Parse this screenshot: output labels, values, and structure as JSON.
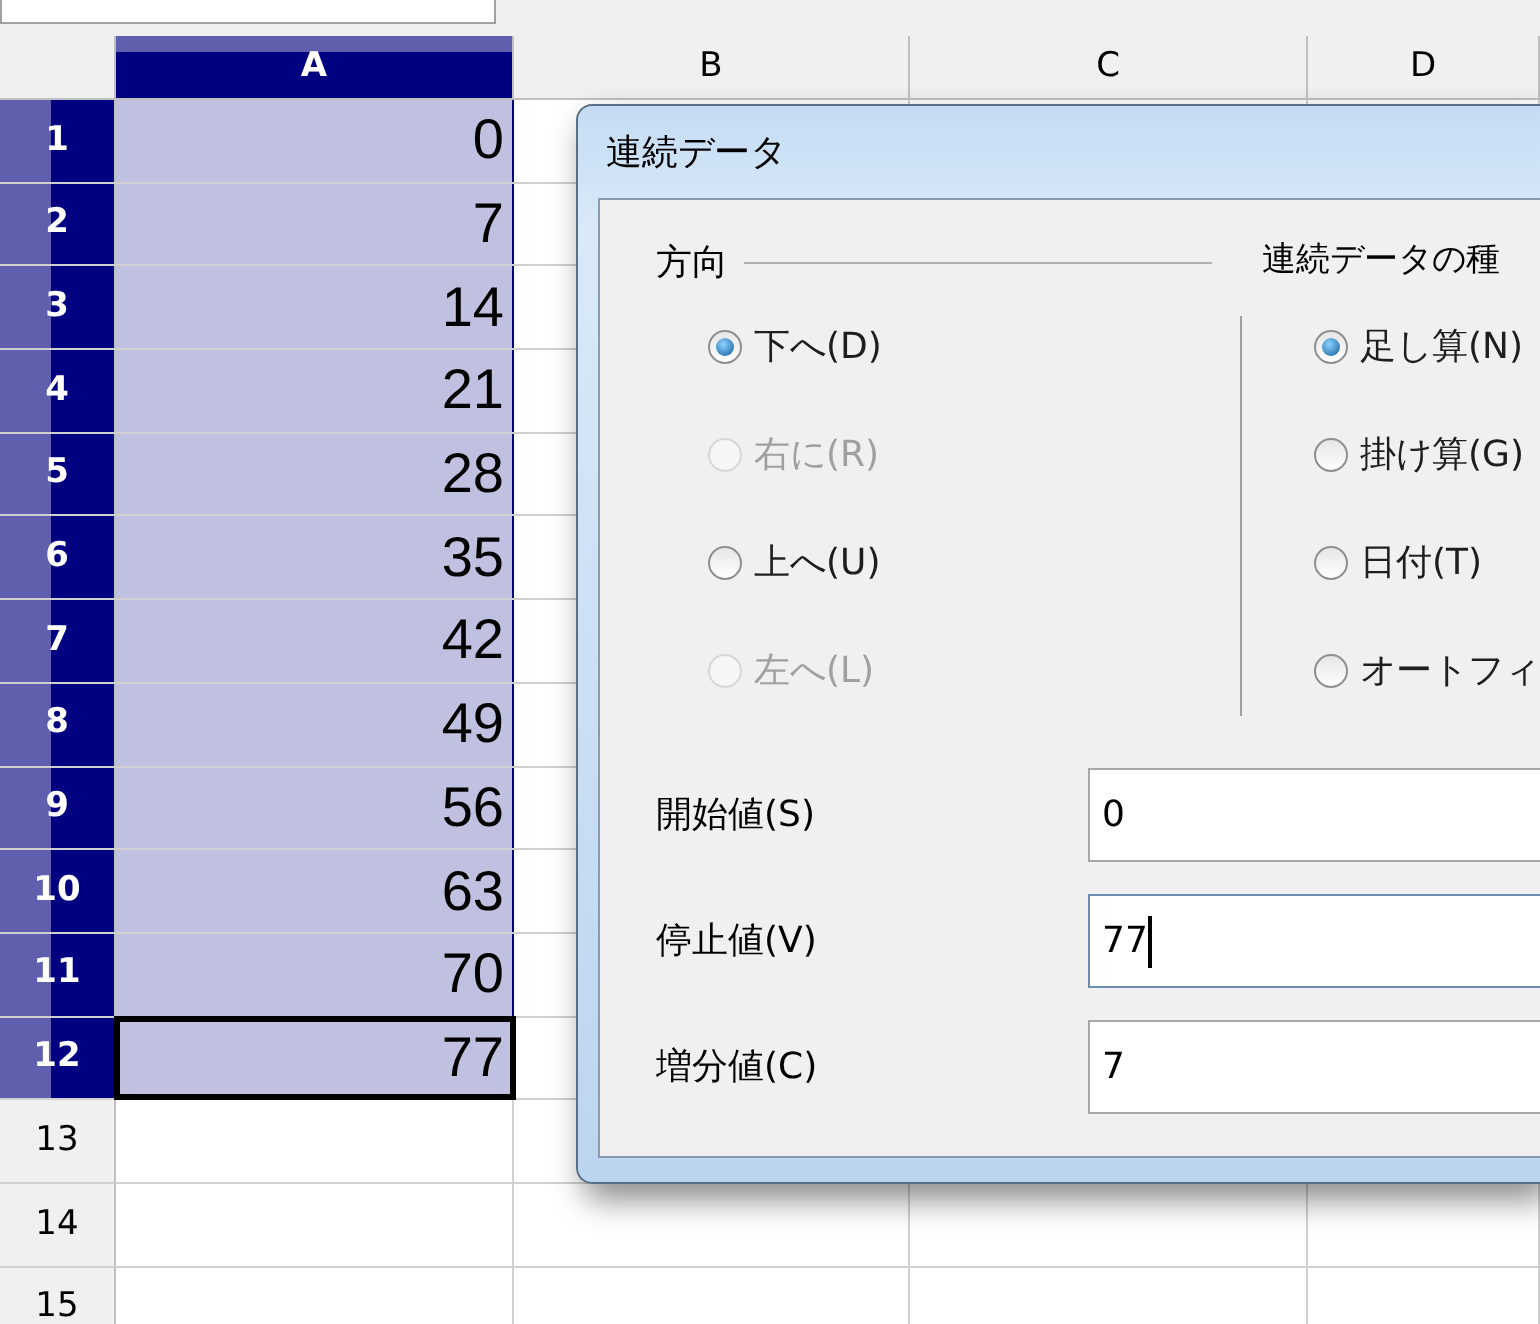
{
  "column_headers": [
    {
      "label": "A",
      "selected": true
    },
    {
      "label": "B",
      "selected": false
    },
    {
      "label": "C",
      "selected": false
    },
    {
      "label": "D",
      "selected": false
    }
  ],
  "rows": [
    {
      "header": "1",
      "selected": true,
      "active": false,
      "value": "0"
    },
    {
      "header": "2",
      "selected": true,
      "active": false,
      "value": "7"
    },
    {
      "header": "3",
      "selected": true,
      "active": false,
      "value": "14"
    },
    {
      "header": "4",
      "selected": true,
      "active": false,
      "value": "21"
    },
    {
      "header": "5",
      "selected": true,
      "active": false,
      "value": "28"
    },
    {
      "header": "6",
      "selected": true,
      "active": false,
      "value": "35"
    },
    {
      "header": "7",
      "selected": true,
      "active": false,
      "value": "42"
    },
    {
      "header": "8",
      "selected": true,
      "active": false,
      "value": "49"
    },
    {
      "header": "9",
      "selected": true,
      "active": false,
      "value": "56"
    },
    {
      "header": "10",
      "selected": true,
      "active": false,
      "value": "63"
    },
    {
      "header": "11",
      "selected": true,
      "active": false,
      "value": "70"
    },
    {
      "header": "12",
      "selected": true,
      "active": true,
      "value": "77"
    },
    {
      "header": "13",
      "selected": false,
      "active": false
    },
    {
      "header": "14",
      "selected": false,
      "active": false
    },
    {
      "header": "15",
      "selected": false,
      "active": false
    }
  ],
  "dialog": {
    "title": "連続データ",
    "direction": {
      "label": "方向",
      "options": [
        {
          "label": "下へ(D)",
          "selected": true,
          "disabled": false
        },
        {
          "label": "右に(R)",
          "selected": false,
          "disabled": true
        },
        {
          "label": "上へ(U)",
          "selected": false,
          "disabled": false
        },
        {
          "label": "左へ(L)",
          "selected": false,
          "disabled": true
        }
      ]
    },
    "series_type": {
      "label": "連続データの種",
      "options": [
        {
          "label": "足し算(N)",
          "selected": true,
          "disabled": false
        },
        {
          "label": "掛け算(G)",
          "selected": false,
          "disabled": false
        },
        {
          "label": "日付(T)",
          "selected": false,
          "disabled": false
        },
        {
          "label": "オートフィ",
          "selected": false,
          "disabled": false
        }
      ]
    },
    "fields": [
      {
        "label": "開始値(S)",
        "value": "0",
        "focused": false
      },
      {
        "label": "停止値(V)",
        "value": "77",
        "focused": true
      },
      {
        "label": "増分値(C)",
        "value": "7",
        "focused": false
      }
    ]
  }
}
